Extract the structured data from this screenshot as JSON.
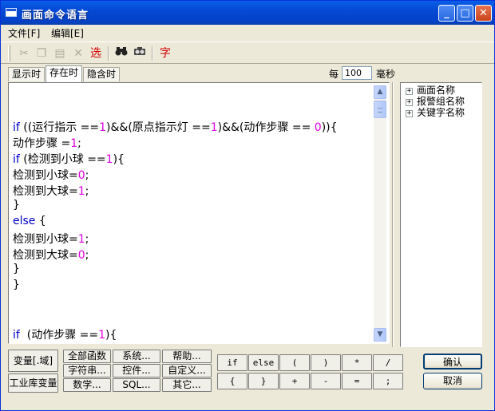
{
  "window": {
    "title": "画面命令语言"
  },
  "menu": {
    "file": "文件[F]",
    "edit": "编辑[E]"
  },
  "toolbar": {
    "select_label": "选",
    "font_label": "字"
  },
  "tabs": [
    "显示时",
    "存在时",
    "隐含时"
  ],
  "period": {
    "label": "每",
    "value": "100",
    "unit": "毫秒"
  },
  "code_lines": [
    {
      "parts": []
    },
    {
      "parts": []
    },
    {
      "parts": [
        {
          "t": "if",
          "c": "kw"
        },
        {
          "t": " ((运行指示 ==",
          "c": ""
        },
        {
          "t": "1",
          "c": "num"
        },
        {
          "t": ")&&(原点指示灯 ==",
          "c": ""
        },
        {
          "t": "1",
          "c": "num"
        },
        {
          "t": ")&&(动作步骤 == ",
          "c": ""
        },
        {
          "t": "0",
          "c": "num"
        },
        {
          "t": ")){",
          "c": ""
        }
      ]
    },
    {
      "parts": [
        {
          "t": "动作步骤 =",
          "c": ""
        },
        {
          "t": "1",
          "c": "num"
        },
        {
          "t": ";",
          "c": ""
        }
      ]
    },
    {
      "parts": [
        {
          "t": "if",
          "c": "kw"
        },
        {
          "t": " (检测到小球 ==",
          "c": ""
        },
        {
          "t": "1",
          "c": "num"
        },
        {
          "t": "){",
          "c": ""
        }
      ]
    },
    {
      "parts": [
        {
          "t": "检测到小球=",
          "c": ""
        },
        {
          "t": "0",
          "c": "num"
        },
        {
          "t": ";",
          "c": ""
        }
      ]
    },
    {
      "parts": [
        {
          "t": "检测到大球=",
          "c": ""
        },
        {
          "t": "1",
          "c": "num"
        },
        {
          "t": ";",
          "c": ""
        }
      ]
    },
    {
      "parts": [
        {
          "t": "}",
          "c": ""
        }
      ]
    },
    {
      "parts": [
        {
          "t": "else",
          "c": "kw"
        },
        {
          "t": " {",
          "c": ""
        }
      ]
    },
    {
      "parts": [
        {
          "t": "检测到小球=",
          "c": ""
        },
        {
          "t": "1",
          "c": "num"
        },
        {
          "t": ";",
          "c": ""
        }
      ]
    },
    {
      "parts": [
        {
          "t": "检测到大球=",
          "c": ""
        },
        {
          "t": "0",
          "c": "num"
        },
        {
          "t": ";",
          "c": ""
        }
      ]
    },
    {
      "parts": [
        {
          "t": "}",
          "c": ""
        }
      ]
    },
    {
      "parts": [
        {
          "t": "}",
          "c": ""
        }
      ]
    },
    {
      "parts": []
    },
    {
      "parts": []
    },
    {
      "parts": [
        {
          "t": "if",
          "c": "kw"
        },
        {
          "t": "  (动作步骤 ==",
          "c": ""
        },
        {
          "t": "1",
          "c": "num"
        },
        {
          "t": "){",
          "c": ""
        }
      ]
    }
  ],
  "tree": [
    "画面名称",
    "报警组名称",
    "关键字名称"
  ],
  "buttons": {
    "variable": "变量[.域]",
    "industrial_db_variable": "工业库变量",
    "all_functions": "全部函数",
    "system": "系统...",
    "help": "帮助...",
    "string": "字符串...",
    "control": "控件...",
    "custom": "自定义...",
    "math": "数学...",
    "sql": "SQL...",
    "other": "其它...",
    "ok": "确认",
    "cancel": "取消"
  },
  "code_buttons_row1": [
    "if",
    "else",
    "(",
    ")",
    "*",
    "/"
  ],
  "code_buttons_row2": [
    "{",
    "}",
    "+",
    "-",
    "=",
    ";"
  ]
}
